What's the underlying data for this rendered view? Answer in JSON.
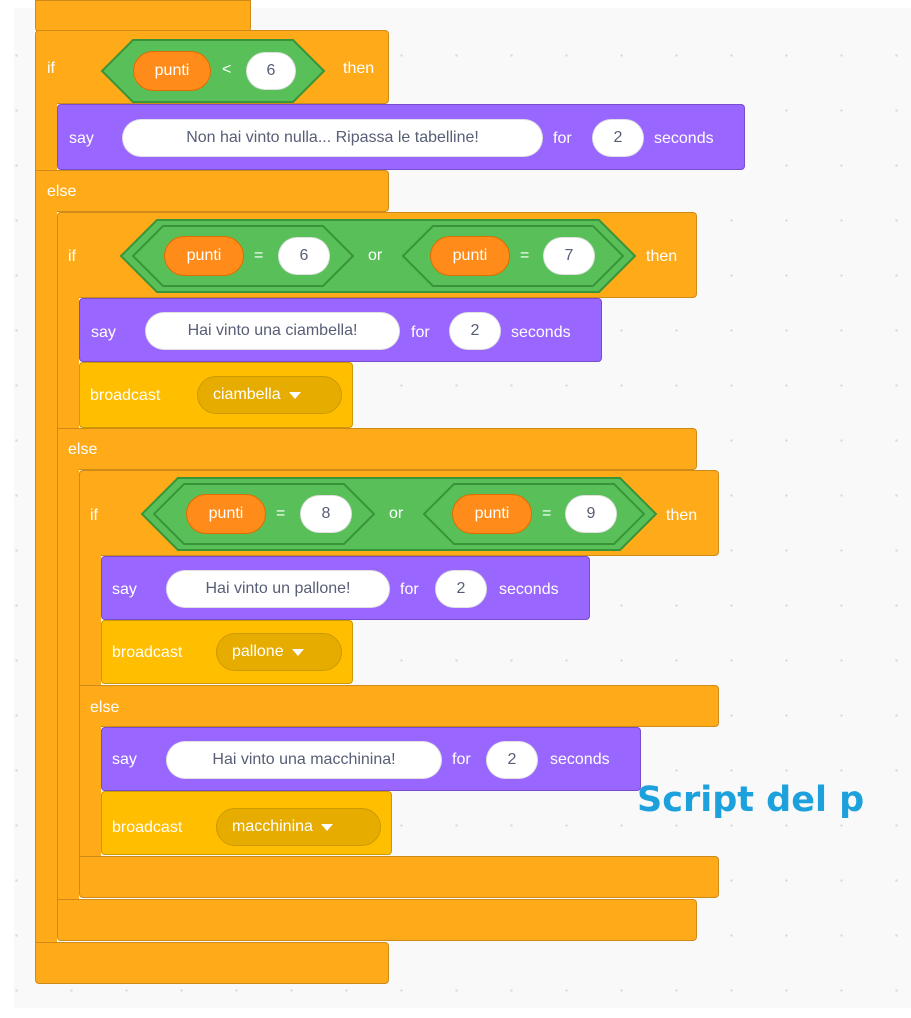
{
  "colors": {
    "control": "#ffab19",
    "looks": "#9966ff",
    "events": "#ffbf00",
    "operators": "#59c059",
    "variables": "#ff8c1a",
    "title": "#1ca1dd"
  },
  "keywords": {
    "if": "if",
    "then": "then",
    "else": "else",
    "say": "say",
    "for": "for",
    "seconds": "seconds",
    "broadcast": "broadcast",
    "or": "or",
    "lt": "<",
    "eq": "="
  },
  "variable_name": "punti",
  "cond1": {
    "value": "6"
  },
  "cond2": {
    "left_value": "6",
    "right_value": "7"
  },
  "cond3": {
    "left_value": "8",
    "right_value": "9"
  },
  "say1": {
    "message": "Non hai vinto nulla... Ripassa le tabelline!",
    "secs": "2"
  },
  "say2": {
    "message": "Hai vinto una ciambella!",
    "secs": "2"
  },
  "say3": {
    "message": "Hai vinto un pallone!",
    "secs": "2"
  },
  "say4": {
    "message": "Hai vinto una macchinina!",
    "secs": "2"
  },
  "broadcast1": {
    "message": "ciambella"
  },
  "broadcast2": {
    "message": "pallone"
  },
  "broadcast3": {
    "message": "macchinina"
  },
  "title": "Script del p"
}
